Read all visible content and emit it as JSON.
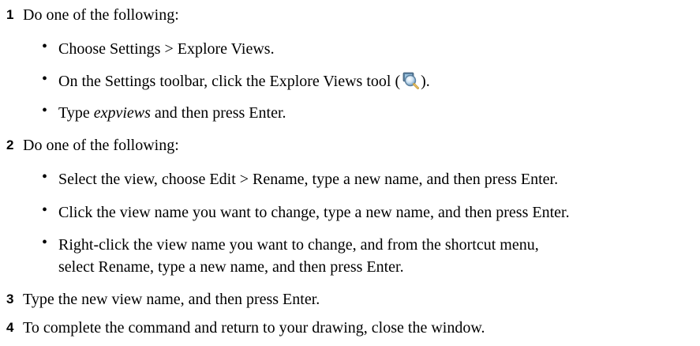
{
  "steps": [
    {
      "number": "1",
      "text": "Do one of the following:",
      "bullets": [
        {
          "text": "Choose Settings > Explore Views."
        },
        {
          "text_before": "On the Settings toolbar, click the Explore Views tool (",
          "icon": "explore-views-icon",
          "text_after": ")."
        },
        {
          "italic": "expviews",
          "text_before": "Type ",
          "text_after": " and then press Enter."
        }
      ]
    },
    {
      "number": "2",
      "text": "Do one of the following:",
      "bullets": [
        {
          "text": "Select the view, choose Edit > Rename, type a new name, and then press Enter."
        },
        {
          "text": "Click the view name you want to change, type a new name, and then press Enter."
        },
        {
          "line1": "Right-click the view name you want to change, and from the shortcut menu,",
          "line2": "select Rename, type a new name, and then press Enter."
        }
      ]
    },
    {
      "number": "3",
      "text": "Type the new view name, and then press Enter."
    },
    {
      "number": "4",
      "text": "To complete the command and return to your drawing, close the window."
    }
  ],
  "bullet_glyph": "•"
}
